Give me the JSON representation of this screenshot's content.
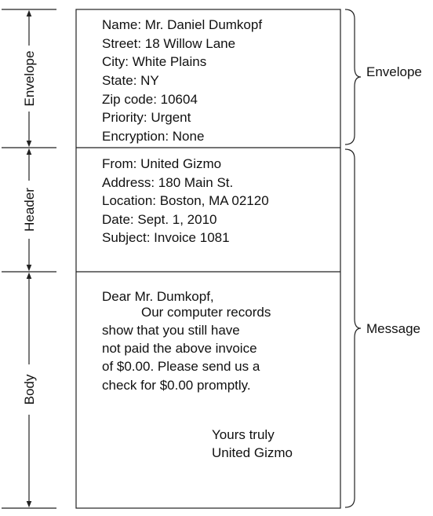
{
  "envelope_section": {
    "lines": [
      "Name: Mr. Daniel Dumkopf",
      "Street: 18 Willow Lane",
      "City: White Plains",
      "State: NY",
      "Zip code: 10604",
      "Priority: Urgent",
      "Encryption: None"
    ]
  },
  "header_section": {
    "lines": [
      "From: United Gizmo",
      "Address: 180 Main St.",
      "Location: Boston, MA 02120",
      "Date: Sept. 1, 2010",
      "Subject: Invoice 1081"
    ]
  },
  "body_section": {
    "lines": [
      "Dear Mr. Dumkopf,",
      "Our computer records",
      "show that you still have",
      "not paid the above invoice",
      "of $0.00. Please send us a",
      "check for $0.00 promptly."
    ],
    "signoff": [
      "Yours truly",
      "United Gizmo"
    ]
  },
  "left_labels": {
    "envelope": "Envelope",
    "header": "Header",
    "body": "Body"
  },
  "right_labels": {
    "envelope": "Envelope",
    "message": "Message"
  }
}
